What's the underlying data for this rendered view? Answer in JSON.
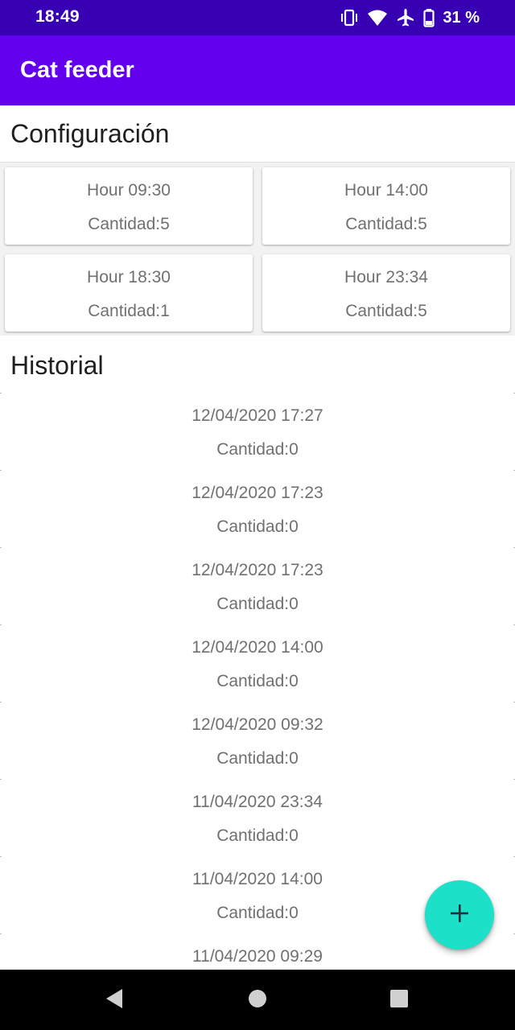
{
  "status_bar": {
    "time": "18:49",
    "battery_percent": "31 %",
    "icons": [
      "vibrate-icon",
      "wifi-icon",
      "airplane-icon",
      "battery-icon"
    ]
  },
  "app_bar": {
    "title": "Cat feeder",
    "color": "#6200ee"
  },
  "config": {
    "title": "Configuración",
    "cards": [
      {
        "hour": "Hour 09:30",
        "quantity": "Cantidad:5"
      },
      {
        "hour": "Hour 14:00",
        "quantity": "Cantidad:5"
      },
      {
        "hour": "Hour 18:30",
        "quantity": "Cantidad:1"
      },
      {
        "hour": "Hour 23:34",
        "quantity": "Cantidad:5"
      }
    ]
  },
  "history": {
    "title": "Historial",
    "items": [
      {
        "date": "12/04/2020 17:27",
        "quantity": "Cantidad:0"
      },
      {
        "date": "12/04/2020 17:23",
        "quantity": "Cantidad:0"
      },
      {
        "date": "12/04/2020 17:23",
        "quantity": "Cantidad:0"
      },
      {
        "date": "12/04/2020 14:00",
        "quantity": "Cantidad:0"
      },
      {
        "date": "12/04/2020 09:32",
        "quantity": "Cantidad:0"
      },
      {
        "date": "11/04/2020 23:34",
        "quantity": "Cantidad:0"
      },
      {
        "date": "11/04/2020 14:00",
        "quantity": "Cantidad:0"
      },
      {
        "date": "11/04/2020 09:29",
        "quantity": ""
      }
    ]
  },
  "fab": {
    "icon": "plus-icon",
    "color": "#1de0c8"
  },
  "nav_bar": {
    "buttons": [
      "back-icon",
      "home-icon",
      "recents-icon"
    ]
  }
}
